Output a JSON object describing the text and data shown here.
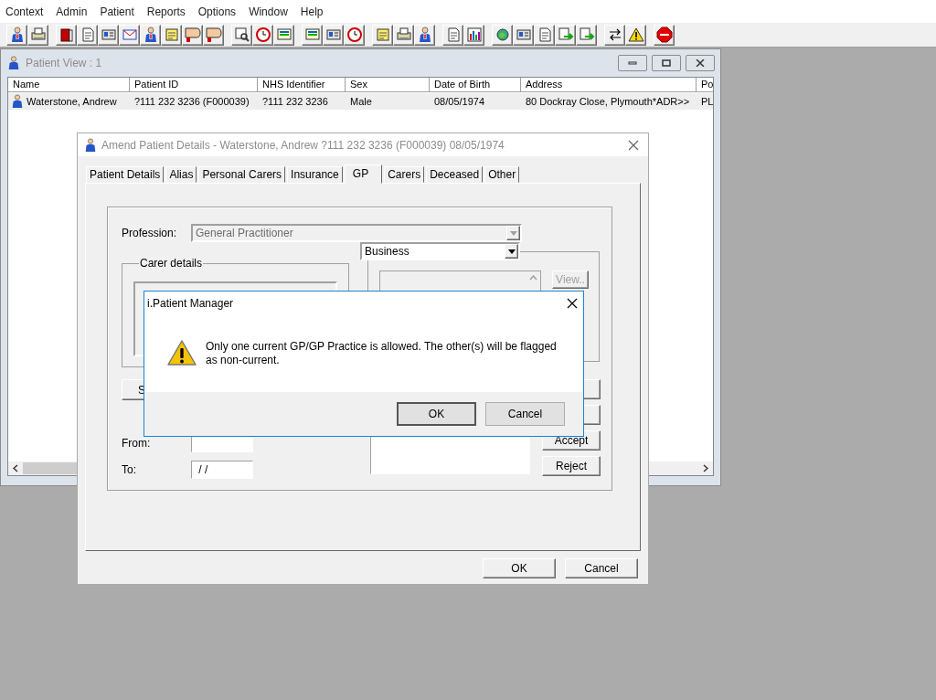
{
  "menu": [
    "Context",
    "Admin",
    "Patient",
    "Reports",
    "Options",
    "Window",
    "Help"
  ],
  "patient_view": {
    "title": "Patient View : 1",
    "columns": [
      "Name",
      "Patient ID",
      "NHS Identifier",
      "Sex",
      "Date of Birth",
      "Address",
      "Po"
    ],
    "rows": [
      {
        "cells": [
          "Waterstone, Andrew",
          "?111 232 3236 (F000039)",
          "?111 232 3236",
          "Male",
          "08/05/1974",
          "80 Dockray Close, Plymouth*ADR>>",
          "PL"
        ]
      }
    ]
  },
  "amend_dialog": {
    "title": "Amend Patient Details - Waterstone, Andrew ?111 232 3236 (F000039) 08/05/1974",
    "tabs": [
      {
        "label": "Patient Details",
        "selected": false
      },
      {
        "label": "Alias",
        "selected": false
      },
      {
        "label": "Personal Carers",
        "selected": false
      },
      {
        "label": "Insurance",
        "selected": false
      },
      {
        "label": "GP",
        "selected": true
      },
      {
        "label": "Carers",
        "selected": false
      },
      {
        "label": "Deceased",
        "selected": false
      },
      {
        "label": "Other",
        "selected": false
      }
    ],
    "profession": {
      "label": "Profession:",
      "value": "General Practitioner",
      "disabled": true
    },
    "carer_details": "Carer details",
    "address_type": "Business",
    "view_button": "View..",
    "s_button": "S",
    "from_label": "From:",
    "to_label": "To:",
    "to_value": " / /",
    "side_buttons": [
      "Accept",
      "Reject"
    ],
    "buttons": [
      "OK",
      "Cancel"
    ]
  },
  "message_box": {
    "title": "i.Patient Manager",
    "text": "Only one current GP/GP Practice is allowed. The other(s) will be flagged as non-current.",
    "buttons": [
      "OK",
      "Cancel"
    ]
  }
}
